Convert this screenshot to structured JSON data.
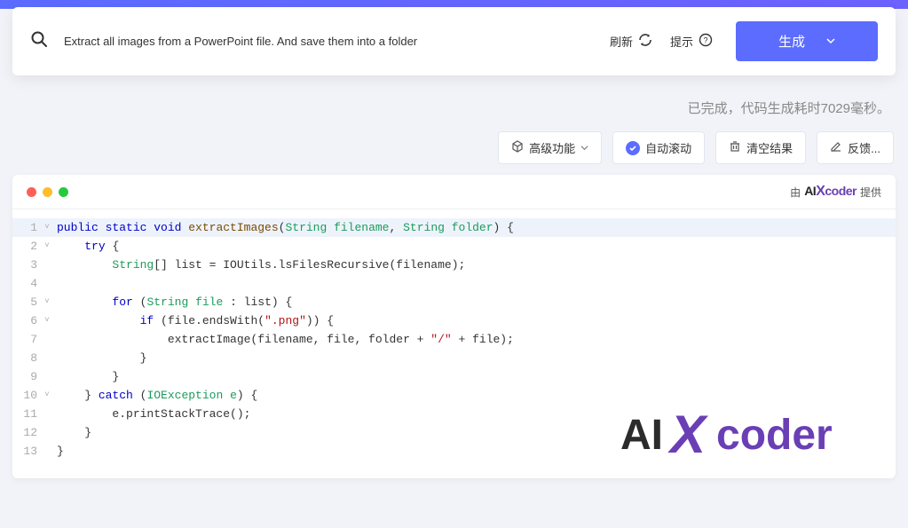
{
  "search": {
    "value": "Extract all images from a PowerPoint file. And save them into a folder"
  },
  "actions": {
    "refresh": "刷新",
    "hint": "提示",
    "generate": "生成"
  },
  "status": "已完成，代码生成耗时7029毫秒。",
  "toolbar": {
    "advanced": "高级功能",
    "autoscroll": "自动滚动",
    "clear": "清空结果",
    "feedback": "反馈..."
  },
  "provider": {
    "by": "由",
    "brand_ai": "AI",
    "brand_x": "X",
    "brand_coder": "coder",
    "suffix": "提供"
  },
  "code": {
    "lines": [
      {
        "n": "1",
        "fold": "˅",
        "hl": true,
        "tokens": [
          {
            "t": "public ",
            "c": "kw"
          },
          {
            "t": "static ",
            "c": "kw"
          },
          {
            "t": "void ",
            "c": "kw"
          },
          {
            "t": "extractImages",
            "c": "fn"
          },
          {
            "t": "(",
            "c": "ident"
          },
          {
            "t": "String ",
            "c": "type"
          },
          {
            "t": "filename",
            "c": "var"
          },
          {
            "t": ", ",
            "c": "ident"
          },
          {
            "t": "String ",
            "c": "type"
          },
          {
            "t": "folder",
            "c": "var"
          },
          {
            "t": ") {",
            "c": "ident"
          }
        ]
      },
      {
        "n": "2",
        "fold": "˅",
        "tokens": [
          {
            "t": "    ",
            "c": ""
          },
          {
            "t": "try ",
            "c": "kw"
          },
          {
            "t": "{",
            "c": "ident"
          }
        ]
      },
      {
        "n": "3",
        "fold": "",
        "tokens": [
          {
            "t": "        ",
            "c": ""
          },
          {
            "t": "String",
            "c": "type"
          },
          {
            "t": "[] list = IOUtils.lsFilesRecursive(filename);",
            "c": "ident"
          }
        ]
      },
      {
        "n": "4",
        "fold": "",
        "tokens": [
          {
            "t": "",
            "c": ""
          }
        ]
      },
      {
        "n": "5",
        "fold": "˅",
        "tokens": [
          {
            "t": "        ",
            "c": ""
          },
          {
            "t": "for ",
            "c": "kw"
          },
          {
            "t": "(",
            "c": "ident"
          },
          {
            "t": "String ",
            "c": "type"
          },
          {
            "t": "file ",
            "c": "var"
          },
          {
            "t": ": list) {",
            "c": "ident"
          }
        ]
      },
      {
        "n": "6",
        "fold": "˅",
        "tokens": [
          {
            "t": "            ",
            "c": ""
          },
          {
            "t": "if ",
            "c": "kw"
          },
          {
            "t": "(file.endsWith(",
            "c": "ident"
          },
          {
            "t": "\".png\"",
            "c": "str"
          },
          {
            "t": ")) {",
            "c": "ident"
          }
        ]
      },
      {
        "n": "7",
        "fold": "",
        "tokens": [
          {
            "t": "                extractImage(filename, file, folder + ",
            "c": "ident"
          },
          {
            "t": "\"/\"",
            "c": "str"
          },
          {
            "t": " + file);",
            "c": "ident"
          }
        ]
      },
      {
        "n": "8",
        "fold": "",
        "tokens": [
          {
            "t": "            }",
            "c": "ident"
          }
        ]
      },
      {
        "n": "9",
        "fold": "",
        "tokens": [
          {
            "t": "        }",
            "c": "ident"
          }
        ]
      },
      {
        "n": "10",
        "fold": "˅",
        "tokens": [
          {
            "t": "    } ",
            "c": "ident"
          },
          {
            "t": "catch ",
            "c": "kw"
          },
          {
            "t": "(",
            "c": "ident"
          },
          {
            "t": "IOException ",
            "c": "type"
          },
          {
            "t": "e",
            "c": "var"
          },
          {
            "t": ") {",
            "c": "ident"
          }
        ]
      },
      {
        "n": "11",
        "fold": "",
        "tokens": [
          {
            "t": "        e.printStackTrace();",
            "c": "ident"
          }
        ]
      },
      {
        "n": "12",
        "fold": "",
        "tokens": [
          {
            "t": "    }",
            "c": "ident"
          }
        ]
      },
      {
        "n": "13",
        "fold": "",
        "tokens": [
          {
            "t": "}",
            "c": "ident"
          }
        ]
      }
    ]
  },
  "watermark": {
    "ai": "AI",
    "x": "X",
    "coder": "coder"
  }
}
